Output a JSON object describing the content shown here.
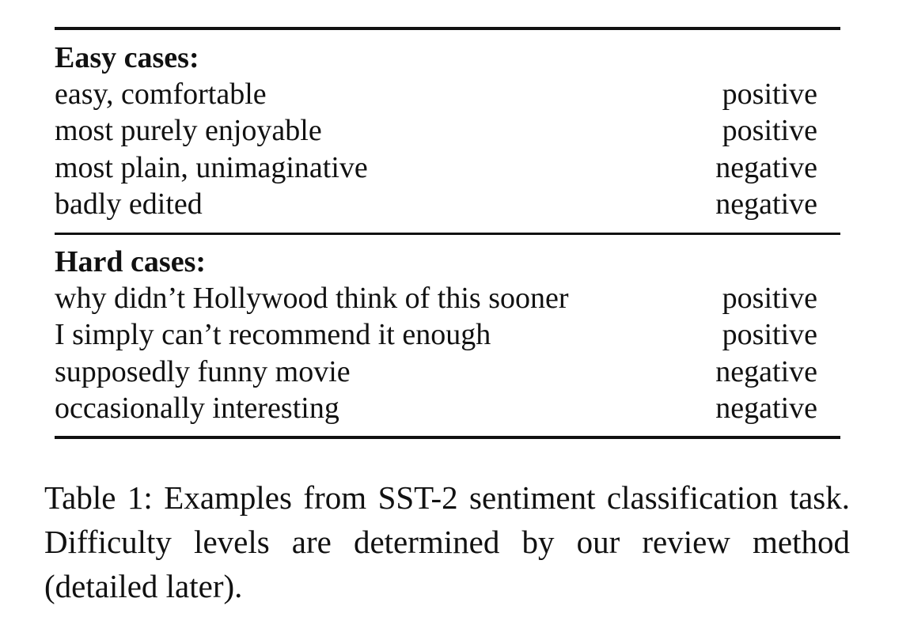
{
  "table": {
    "sections": [
      {
        "title": "Easy cases:",
        "rows": [
          {
            "text": "easy, comfortable",
            "label": "positive"
          },
          {
            "text": "most purely enjoyable",
            "label": "positive"
          },
          {
            "text": "most plain, unimaginative",
            "label": "negative"
          },
          {
            "text": "badly edited",
            "label": "negative"
          }
        ]
      },
      {
        "title": "Hard cases:",
        "rows": [
          {
            "text": "why didn’t Hollywood think of this sooner",
            "label": "positive"
          },
          {
            "text": "I simply can’t recommend it enough",
            "label": "positive"
          },
          {
            "text": "supposedly funny movie",
            "label": "negative"
          },
          {
            "text": "occasionally interesting",
            "label": "negative"
          }
        ]
      }
    ]
  },
  "caption": "Table 1: Examples from SST-2 sentiment classification task.  Difficulty levels are determined by our review method (detailed later)."
}
